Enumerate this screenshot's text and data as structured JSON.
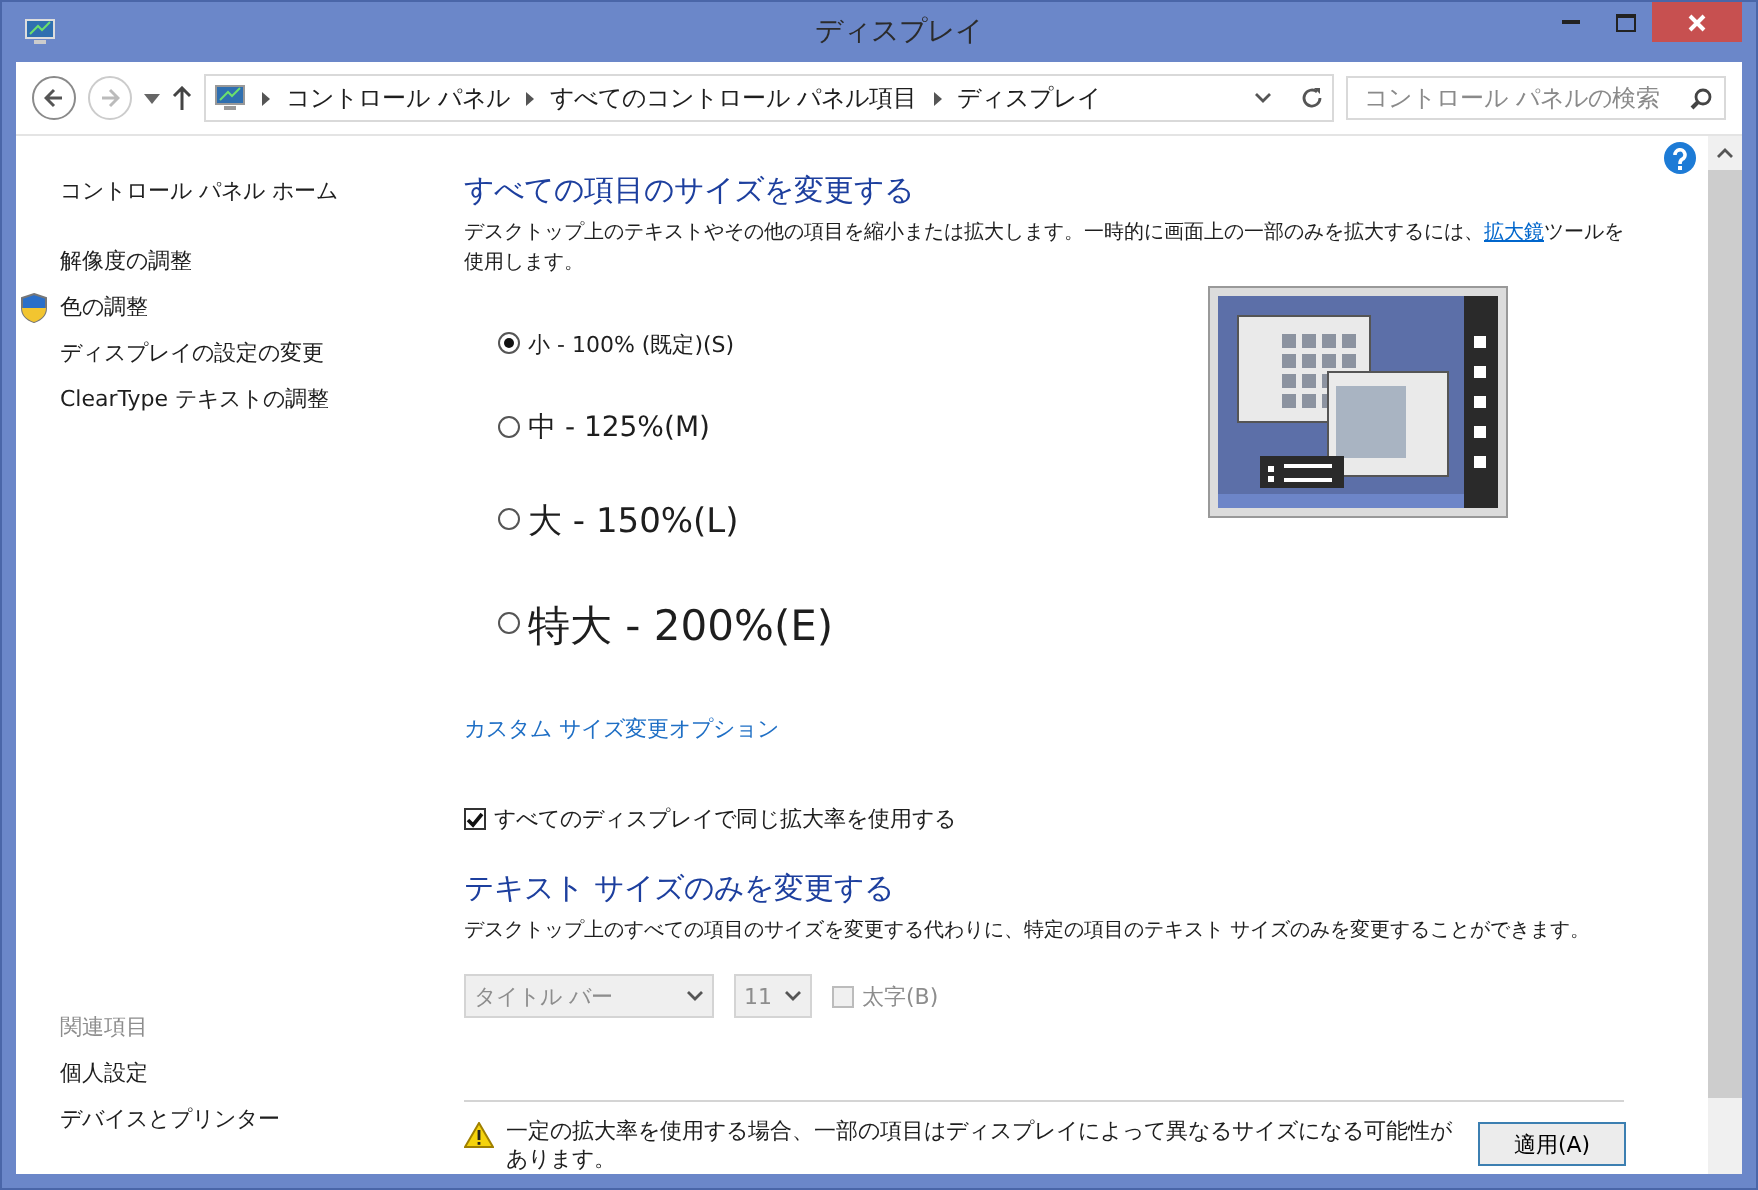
{
  "window": {
    "title": "ディスプレイ"
  },
  "address_bar": {
    "path": [
      "コントロール パネル",
      "すべてのコントロール パネル項目",
      "ディスプレイ"
    ],
    "search": {
      "placeholder": "コントロール パネルの検索"
    }
  },
  "sidebar": {
    "home": "コントロール パネル ホーム",
    "links": [
      {
        "label": "解像度の調整",
        "kind": "plain"
      },
      {
        "label": "色の調整",
        "kind": "shield"
      },
      {
        "label": "ディスプレイの設定の変更",
        "kind": "plain"
      },
      {
        "label": "ClearType テキストの調整",
        "kind": "plain"
      }
    ],
    "related": {
      "heading": "関連項目",
      "links": [
        "個人設定",
        "デバイスとプリンター"
      ]
    }
  },
  "size_section": {
    "title": "すべての項目のサイズを変更する",
    "description": {
      "before": "デスクトップ上のテキストやその他の項目を縮小または拡大します。一時的に画面上の一部のみを拡大するには、",
      "link": "拡大鏡",
      "after": "ツールを使用します。"
    },
    "options": [
      {
        "label": "小 - 100% (既定)(S)",
        "kind": "small",
        "selected": true
      },
      {
        "label": "中 - 125%(M)",
        "kind": "medium",
        "selected": false
      },
      {
        "label": "大 - 150%(L)",
        "kind": "large",
        "selected": false
      },
      {
        "label": "特大 - 200%(E)",
        "kind": "xlarge",
        "selected": false
      }
    ],
    "custom_link": "カスタム サイズ変更オプション",
    "same_scale": {
      "label": "すべてのディスプレイで同じ拡大率を使用する",
      "checked": true
    }
  },
  "text_section": {
    "title": "テキスト サイズのみを変更する",
    "description": "デスクトップ上のすべての項目のサイズを変更する代わりに、特定の項目のテキスト サイズのみを変更することができます。",
    "item": {
      "value": "タイトル バー",
      "disabled": true
    },
    "size": {
      "value": "11",
      "disabled": true
    },
    "bold": {
      "label": "太字(B)",
      "checked": false,
      "disabled": true
    }
  },
  "footer": {
    "warning": "一定の拡大率を使用する場合、一部の項目はディスプレイによって異なるサイズになる可能性があります。",
    "apply": "適用(A)"
  }
}
